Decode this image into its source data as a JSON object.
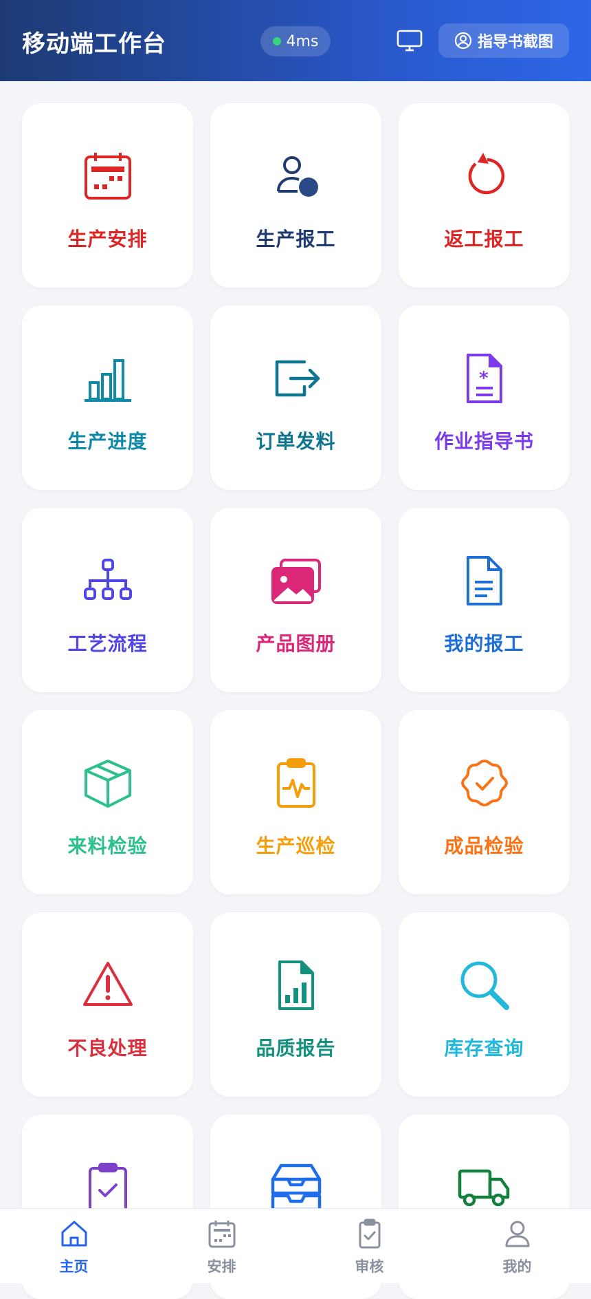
{
  "header": {
    "title": "移动端工作台",
    "latency": "4ms",
    "guide_button": "指导书截图"
  },
  "tiles": [
    {
      "label": "生产安排",
      "icon": "calendar-icon",
      "color": "#dc2626"
    },
    {
      "label": "生产报工",
      "icon": "user-report-icon",
      "color": "#1e3a6e"
    },
    {
      "label": "返工报工",
      "icon": "rework-rotate-icon",
      "color": "#dc2626"
    },
    {
      "label": "生产进度",
      "icon": "bar-chart-icon",
      "color": "#0e8aa8"
    },
    {
      "label": "订单发料",
      "icon": "export-icon",
      "color": "#0e7490"
    },
    {
      "label": "作业指导书",
      "icon": "document-star-icon",
      "color": "#7c3aed"
    },
    {
      "label": "工艺流程",
      "icon": "org-chart-icon",
      "color": "#4f46e5"
    },
    {
      "label": "产品图册",
      "icon": "gallery-icon",
      "color": "#db2777"
    },
    {
      "label": "我的报工",
      "icon": "document-icon",
      "color": "#1d6fd6"
    },
    {
      "label": "来料检验",
      "icon": "box-icon",
      "color": "#2cc08f"
    },
    {
      "label": "生产巡检",
      "icon": "clipboard-pulse-icon",
      "color": "#f59e0b"
    },
    {
      "label": "成品检验",
      "icon": "badge-check-icon",
      "color": "#f97316"
    },
    {
      "label": "不良处理",
      "icon": "warning-icon",
      "color": "#dc2f3e"
    },
    {
      "label": "品质报告",
      "icon": "file-chart-icon",
      "color": "#14907e"
    },
    {
      "label": "库存查询",
      "icon": "search-icon",
      "color": "#22b8dc"
    },
    {
      "label": "",
      "icon": "clipboard-check-icon",
      "color": "#7e3fc9"
    },
    {
      "label": "",
      "icon": "inbox-icon",
      "color": "#1f6de8"
    },
    {
      "label": "",
      "icon": "truck-icon",
      "color": "#15803d"
    }
  ],
  "tabs": [
    {
      "label": "主页",
      "icon": "home-icon",
      "active": true
    },
    {
      "label": "安排",
      "icon": "calendar-icon",
      "active": false
    },
    {
      "label": "审核",
      "icon": "clipboard-check-icon",
      "active": false
    },
    {
      "label": "我的",
      "icon": "user-icon",
      "active": false
    }
  ],
  "colors": {
    "accent": "#2563eb",
    "tab_inactive": "#8a919e"
  }
}
